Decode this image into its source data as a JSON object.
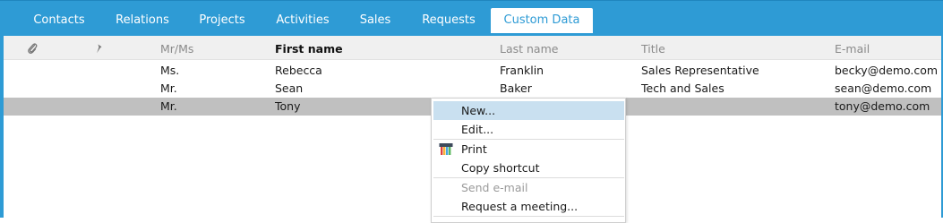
{
  "tabs": [
    {
      "label": "Contacts",
      "active": false
    },
    {
      "label": "Relations",
      "active": false
    },
    {
      "label": "Projects",
      "active": false
    },
    {
      "label": "Activities",
      "active": false
    },
    {
      "label": "Sales",
      "active": false
    },
    {
      "label": "Requests",
      "active": false
    },
    {
      "label": "Custom Data",
      "active": true
    }
  ],
  "columns": {
    "attachment_icon": "paperclip-icon",
    "pin_icon": "pushpin-icon",
    "salutation": "Mr/Ms",
    "first_name": "First name",
    "last_name": "Last name",
    "title": "Title",
    "email": "E-mail"
  },
  "rows": [
    {
      "salutation": "Ms.",
      "first_name": "Rebecca",
      "last_name": "Franklin",
      "title": "Sales Representative",
      "email": "becky@demo.com",
      "selected": false
    },
    {
      "salutation": "Mr.",
      "first_name": "Sean",
      "last_name": "Baker",
      "title": "Tech and Sales",
      "email": "sean@demo.com",
      "selected": false
    },
    {
      "salutation": "Mr.",
      "first_name": "Tony",
      "last_name": "",
      "title": "",
      "email": "tony@demo.com",
      "selected": true
    }
  ],
  "context_menu": {
    "items": [
      {
        "label": "New...",
        "highlighted": true,
        "disabled": false
      },
      {
        "label": "Edit...",
        "highlighted": false,
        "disabled": false
      },
      {
        "label": "Print",
        "icon": "print-icon",
        "highlighted": false,
        "disabled": false
      },
      {
        "label": "Copy shortcut",
        "highlighted": false,
        "disabled": false
      },
      {
        "label": "Send e-mail",
        "highlighted": false,
        "disabled": true
      },
      {
        "label": "Request a meeting...",
        "highlighted": false,
        "disabled": false
      }
    ]
  },
  "colors": {
    "tab_bar": "#2e9bd5",
    "selected_row": "#c0c0c0",
    "menu_highlight": "#c9e0f0"
  }
}
